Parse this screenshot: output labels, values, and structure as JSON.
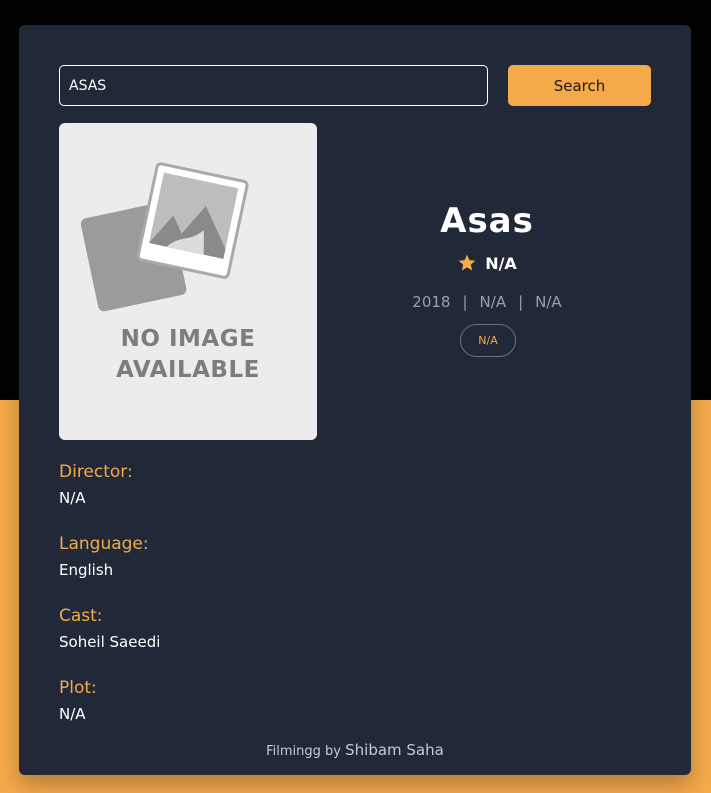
{
  "search": {
    "value": "ASAS",
    "button_label": "Search"
  },
  "poster": {
    "line1": "NO IMAGE",
    "line2": "AVAILABLE"
  },
  "movie": {
    "title": "Asas",
    "rating": "N/A",
    "year": "2018",
    "separator": "|",
    "runtime": "N/A",
    "rated": "N/A",
    "genre": "N/A"
  },
  "details": {
    "director_label": "Director:",
    "director_value": "N/A",
    "language_label": "Language:",
    "language_value": "English",
    "cast_label": "Cast:",
    "cast_value": "Soheil Saeedi",
    "plot_label": "Plot:",
    "plot_value": "N/A"
  },
  "footer": {
    "prefix": "Filmingg by",
    "author": "Shibam Saha"
  },
  "colors": {
    "accent": "#f4a94b",
    "card": "#212938"
  }
}
